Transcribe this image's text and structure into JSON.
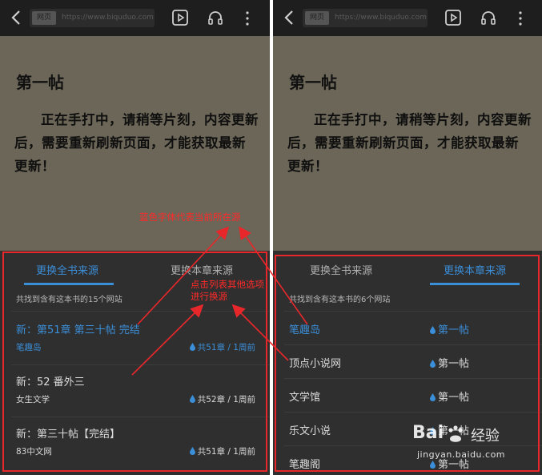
{
  "left": {
    "topbar": {
      "url_tag": "网页",
      "url": "https://www.biquduo.com"
    },
    "reader": {
      "title": "第一帖",
      "body": "正在手打中，请稍等片刻，内容更新后，需要重新刷新页面，才能获取最新更新！"
    },
    "panel": {
      "tabs": [
        "更换全书来源",
        "更换本章来源"
      ],
      "info": "共找到含有这本书的15个网站",
      "sources": [
        {
          "title": "新：第51章 第三十帖 完结",
          "site": "笔趣岛",
          "meta": "共51章 / 1周前"
        },
        {
          "title": "新：52 番外三",
          "site": "女生文学",
          "meta": "共52章 / 1周前"
        },
        {
          "title": "新：第三十帖【完结】",
          "site": "83中文网",
          "meta": "共51章 / 1周前"
        }
      ]
    }
  },
  "right": {
    "topbar": {
      "url_tag": "网页",
      "url": "https://www.biquduo.com"
    },
    "reader": {
      "title": "第一帖",
      "body": "正在手打中，请稍等片刻，内容更新后，需要重新刷新页面，才能获取最新更新！"
    },
    "panel": {
      "tabs": [
        "更换全书来源",
        "更换本章来源"
      ],
      "info": "共找到含有这本书的6个网站",
      "sources": [
        {
          "site": "笔趣岛",
          "chapter": "第一帖"
        },
        {
          "site": "顶点小说网",
          "chapter": "第一帖"
        },
        {
          "site": "文学馆",
          "chapter": "第一帖"
        },
        {
          "site": "乐文小说",
          "chapter": "第一帖"
        },
        {
          "site": "笔趣阁",
          "chapter": "第一帖"
        }
      ]
    }
  },
  "annotations": {
    "blue_note": "蓝色字体代表当前所在源",
    "click_note": "点击列表其他选项\n进行换源"
  },
  "watermark": {
    "brand": "Bai",
    "brand2": "经验",
    "url": "jingyan.baidu.com"
  },
  "colors": {
    "accent": "#3b8ed8",
    "annotation": "#e8272b",
    "panel": "#2f2f2f",
    "reader": "#6b6657"
  }
}
